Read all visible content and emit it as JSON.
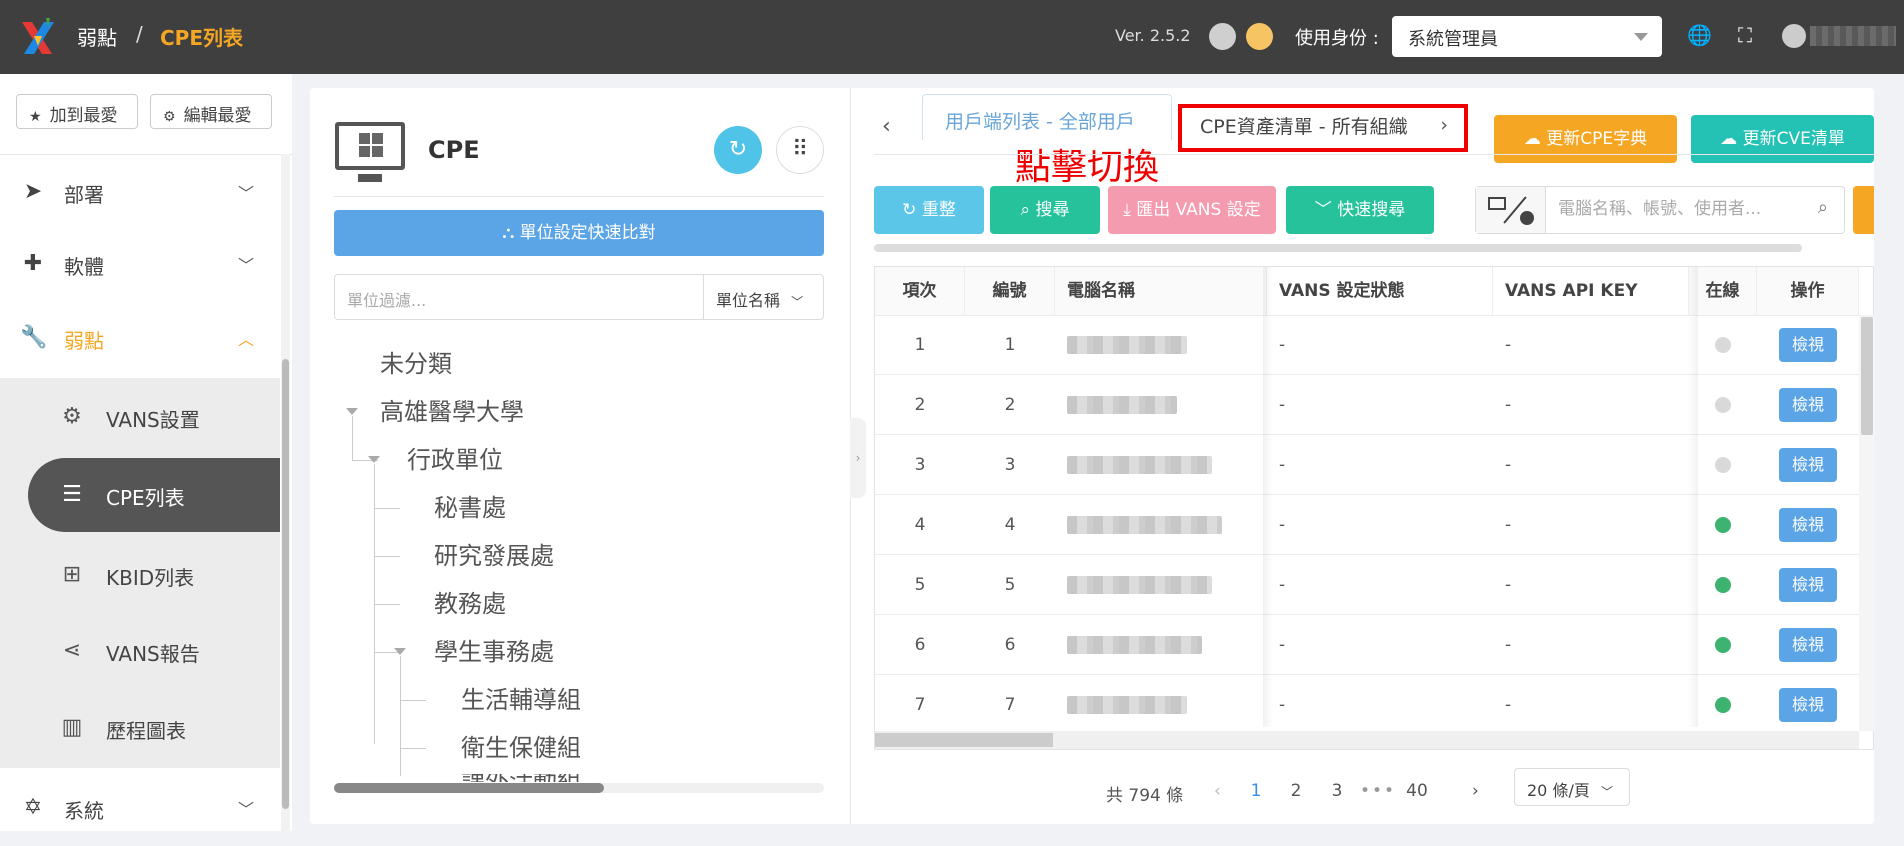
{
  "header": {
    "breadcrumb": [
      "弱點",
      "CPE列表"
    ],
    "breadcrumb_sep": "/",
    "version": "Ver. 2.5.2",
    "role_label": "使用身份 :",
    "role_value": "系統管理員"
  },
  "sidebar": {
    "fav_add": "加到最愛",
    "fav_edit": "編輯最愛",
    "items": [
      {
        "label": "部署",
        "icon": "paper-plane-icon"
      },
      {
        "label": "軟體",
        "icon": "puzzle-icon"
      },
      {
        "label": "弱點",
        "icon": "wrench-icon"
      },
      {
        "label": "系統",
        "icon": "atom-icon"
      }
    ],
    "sub_items": [
      {
        "label": "VANS設置",
        "icon": "gear-icon"
      },
      {
        "label": "CPE列表",
        "icon": "list-icon"
      },
      {
        "label": "KBID列表",
        "icon": "windows-icon"
      },
      {
        "label": "VANS報告",
        "icon": "share-icon"
      },
      {
        "label": "歷程圖表",
        "icon": "bar-chart-icon"
      }
    ],
    "active_color": "#f5a623"
  },
  "tree": {
    "title": "CPE",
    "quick_compare": "單位設定快速比對",
    "filter_placeholder": "單位過濾...",
    "filter_select": "單位名稱",
    "nodes": [
      "未分類",
      "高雄醫學大學",
      "行政單位",
      "秘書處",
      "研究發展處",
      "教務處",
      "學生事務處",
      "生活輔導組",
      "衛生保健組",
      "課外活動組"
    ]
  },
  "tabs": {
    "tab1": "用戶端列表 - 全部用戶",
    "tab2": "CPE資產清單 - 所有組織",
    "annotation": "點擊切換"
  },
  "actions": {
    "update_cpe": "更新CPE字典",
    "update_cve": "更新CVE清單",
    "reset": "重整",
    "search": "搜尋",
    "export": "匯出 VANS 設定",
    "quick_search": "快速搜尋",
    "search_placeholder": "電腦名稱、帳號、使用者..."
  },
  "table": {
    "headers": [
      "項次",
      "編號",
      "電腦名稱",
      "VANS 設定狀態",
      "VANS API KEY",
      "在線",
      "操作"
    ],
    "rows": [
      {
        "idx": "1",
        "num": "1",
        "status": "-",
        "apikey": "-",
        "online": false,
        "action": "檢視"
      },
      {
        "idx": "2",
        "num": "2",
        "status": "-",
        "apikey": "-",
        "online": false,
        "action": "檢視"
      },
      {
        "idx": "3",
        "num": "3",
        "status": "-",
        "apikey": "-",
        "online": false,
        "action": "檢視"
      },
      {
        "idx": "4",
        "num": "4",
        "status": "-",
        "apikey": "-",
        "online": true,
        "action": "檢視"
      },
      {
        "idx": "5",
        "num": "5",
        "status": "-",
        "apikey": "-",
        "online": true,
        "action": "檢視"
      },
      {
        "idx": "6",
        "num": "6",
        "status": "-",
        "apikey": "-",
        "online": true,
        "action": "檢視"
      },
      {
        "idx": "7",
        "num": "7",
        "status": "-",
        "apikey": "-",
        "online": true,
        "action": "檢視"
      }
    ],
    "online_color": "#3cb371",
    "offline_color": "#d9d9d9"
  },
  "pager": {
    "total": "共 794 條",
    "pages": [
      "1",
      "2",
      "3"
    ],
    "ellipsis": "•••",
    "last": "40",
    "current": "1",
    "page_size": "20 條/頁"
  }
}
